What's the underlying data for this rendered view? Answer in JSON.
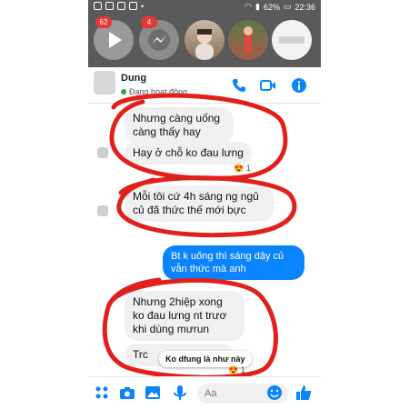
{
  "statusbar": {
    "battery": "62%",
    "time": "22:36"
  },
  "chat_heads": [
    {
      "badge": "62"
    },
    {
      "badge": "4"
    },
    {
      "badge": ""
    },
    {
      "badge": ""
    },
    {
      "badge": ""
    }
  ],
  "header": {
    "name": "Dung",
    "status": "Đang hoạt động"
  },
  "messages": {
    "m1": "Nhưng  càng uống càng thấy hay",
    "m2": "Hay ở chỗ ko đau lưng",
    "m2_reaction": "1",
    "m3": "Mỗi tôi cứ 4h sáng ng ngủ củ đã thức thế mới bực",
    "m4": "Bt k uống  thì  sáng  dậy củ vẫn thức mà anh",
    "m5": "Nhưng 2hiệp xong ko đau lưng nt trươ khi dùng mưrun",
    "m6": "Trc",
    "m6_reaction": "1",
    "tooltip": "Ko dfung là như này"
  },
  "composer": {
    "placeholder": "Aa"
  },
  "colors": {
    "annotation": "#e0201a",
    "accent": "#0a84ff",
    "chat_head_bg": "#5a5a5a"
  }
}
